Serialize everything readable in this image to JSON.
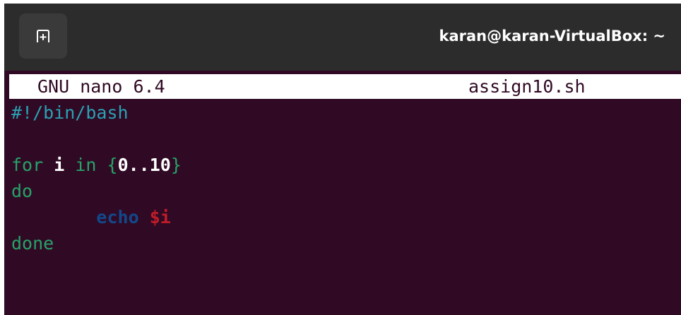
{
  "window": {
    "title": "karan@karan-VirtualBox: ~",
    "new_tab_icon": "new-tab-icon"
  },
  "nano": {
    "version_label": "GNU nano 6.4",
    "filename": "assign10.sh"
  },
  "editor": {
    "lines": [
      [
        {
          "text": "#!/bin/bash",
          "color": "#2aa1b3"
        }
      ],
      [],
      [
        {
          "text": "for",
          "color": "#26a269"
        },
        {
          "text": " "
        },
        {
          "text": "i",
          "color": "#ffffff"
        },
        {
          "text": " "
        },
        {
          "text": "in",
          "color": "#26a269"
        },
        {
          "text": " "
        },
        {
          "text": "{",
          "color": "#26a269"
        },
        {
          "text": "0..10",
          "color": "#ffffff"
        },
        {
          "text": "}",
          "color": "#26a269"
        }
      ],
      [
        {
          "text": "do",
          "color": "#26a269"
        }
      ],
      [
        {
          "text": "        "
        },
        {
          "text": "echo",
          "color": "#12488b"
        },
        {
          "text": " "
        },
        {
          "text": "$i",
          "color": "#c01c28"
        }
      ],
      [
        {
          "text": "done",
          "color": "#26a269"
        }
      ]
    ]
  },
  "colors": {
    "terminal_background": "#300a24",
    "titlebar_background": "#2c2c2c",
    "header_background": "#ffffff"
  }
}
